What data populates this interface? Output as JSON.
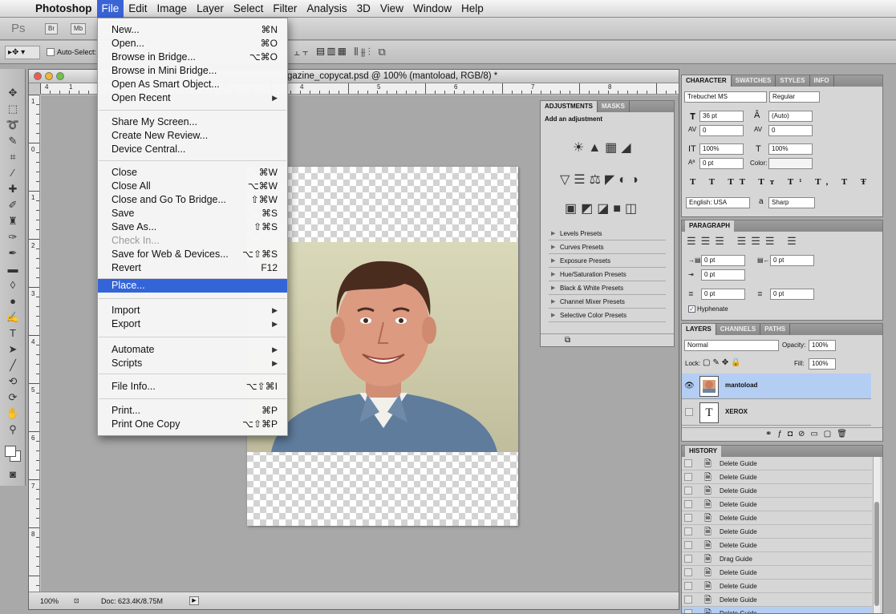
{
  "menubar": {
    "items": [
      "Photoshop",
      "File",
      "Edit",
      "Image",
      "Layer",
      "Select",
      "Filter",
      "Analysis",
      "3D",
      "View",
      "Window",
      "Help"
    ]
  },
  "appbar": {
    "ps": "Ps",
    "bridge": "Br",
    "minibridge": "Mb"
  },
  "options": {
    "auto_select": "Auto-Select:"
  },
  "document": {
    "title": "gazine_copycat.psd @ 100% (mantoload, RGB/8) *",
    "zoom": "100%",
    "doc_size": "Doc: 623.4K/8.75M",
    "h_ruler": [
      "4",
      "1",
      "2",
      "3",
      "4",
      "5",
      "6",
      "7",
      "8"
    ],
    "v_ruler": [
      "1",
      "0",
      "1",
      "2",
      "3",
      "4",
      "5",
      "6",
      "7",
      "8"
    ]
  },
  "file_menu": {
    "items": [
      {
        "label": "New...",
        "shortcut": "⌘N"
      },
      {
        "label": "Open...",
        "shortcut": "⌘O"
      },
      {
        "label": "Browse in Bridge...",
        "shortcut": "⌥⌘O"
      },
      {
        "label": "Browse in Mini Bridge...",
        "shortcut": ""
      },
      {
        "label": "Open As Smart Object...",
        "shortcut": ""
      },
      {
        "label": "Open Recent",
        "shortcut": ""
      },
      {
        "label": "Share My Screen...",
        "shortcut": ""
      },
      {
        "label": "Create New Review...",
        "shortcut": ""
      },
      {
        "label": "Device Central...",
        "shortcut": ""
      },
      {
        "label": "Close",
        "shortcut": "⌘W"
      },
      {
        "label": "Close All",
        "shortcut": "⌥⌘W"
      },
      {
        "label": "Close and Go To Bridge...",
        "shortcut": "⇧⌘W"
      },
      {
        "label": "Save",
        "shortcut": "⌘S"
      },
      {
        "label": "Save As...",
        "shortcut": "⇧⌘S"
      },
      {
        "label": "Check In...",
        "shortcut": ""
      },
      {
        "label": "Save for Web & Devices...",
        "shortcut": "⌥⇧⌘S"
      },
      {
        "label": "Revert",
        "shortcut": "F12"
      },
      {
        "label": "Place...",
        "shortcut": ""
      },
      {
        "label": "Import",
        "shortcut": ""
      },
      {
        "label": "Export",
        "shortcut": ""
      },
      {
        "label": "Automate",
        "shortcut": ""
      },
      {
        "label": "Scripts",
        "shortcut": ""
      },
      {
        "label": "File Info...",
        "shortcut": "⌥⇧⌘I"
      },
      {
        "label": "Print...",
        "shortcut": "⌘P"
      },
      {
        "label": "Print One Copy",
        "shortcut": "⌥⇧⌘P"
      }
    ]
  },
  "adjustments": {
    "tabs": [
      "ADJUSTMENTS",
      "MASKS"
    ],
    "heading": "Add an adjustment",
    "presets": [
      "Levels Presets",
      "Curves Presets",
      "Exposure Presets",
      "Hue/Saturation Presets",
      "Black & White Presets",
      "Channel Mixer Presets",
      "Selective Color Presets"
    ]
  },
  "character": {
    "tabs": [
      "CHARACTER",
      "SWATCHES",
      "STYLES",
      "INFO"
    ],
    "font": "Trebuchet MS",
    "style": "Regular",
    "size": "36 pt",
    "leading": "(Auto)",
    "kerning": "0",
    "tracking": "0",
    "vscale": "100%",
    "hscale": "100%",
    "baseline": "0 pt",
    "color_label": "Color:",
    "language": "English: USA",
    "aa_label": "a",
    "antialias": "Sharp"
  },
  "paragraph": {
    "title": "PARAGRAPH",
    "indent_left": "0 pt",
    "indent_right": "0 pt",
    "indent_first": "0 pt",
    "space_before": "0 pt",
    "space_after": "0 pt",
    "hyphenate": "Hyphenate"
  },
  "layers": {
    "tabs": [
      "LAYERS",
      "CHANNELS",
      "PATHS"
    ],
    "blend": "Normal",
    "opacity_label": "Opacity:",
    "opacity": "100%",
    "lock_label": "Lock:",
    "fill_label": "Fill:",
    "fill": "100%",
    "items": [
      {
        "name": "mantoload",
        "thumb": ""
      },
      {
        "name": "XEROX",
        "thumb": "T"
      }
    ]
  },
  "history": {
    "title": "HISTORY",
    "items": [
      "Delete Guide",
      "Delete Guide",
      "Delete Guide",
      "Delete Guide",
      "Delete Guide",
      "Delete Guide",
      "Delete Guide",
      "Drag Guide",
      "Delete Guide",
      "Delete Guide",
      "Delete Guide",
      "Delete Guide"
    ]
  }
}
